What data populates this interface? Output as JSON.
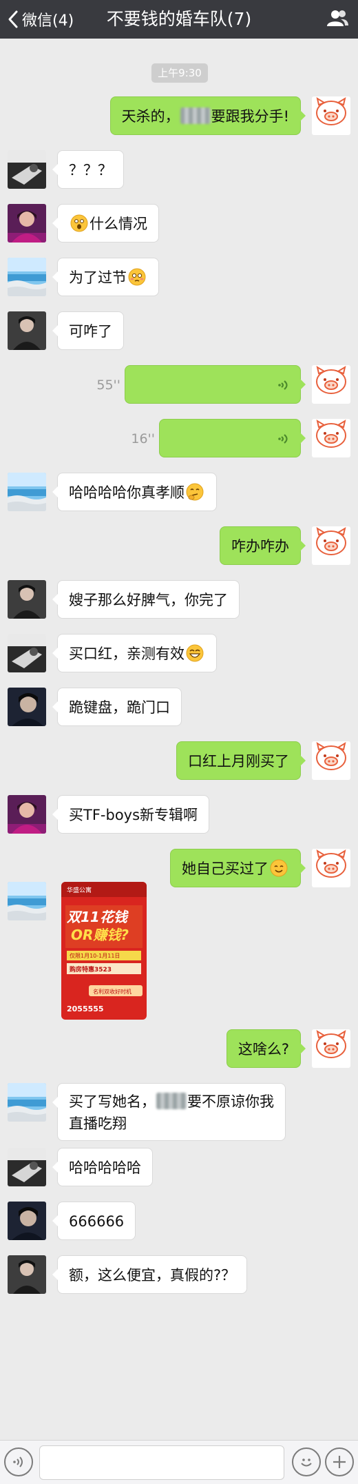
{
  "header": {
    "back_label": "微信(4)",
    "title": "不要钱的婚车队(7)"
  },
  "timestamp": "上午9:30",
  "messages": [
    {
      "side": "right",
      "avatar": "pig",
      "text_before": "天杀的，",
      "text_after": "要跟我分手!"
    },
    {
      "side": "left",
      "avatar": "dark",
      "text": "？？？"
    },
    {
      "side": "left",
      "avatar": "pink",
      "text": "什么情况",
      "emoji": "shocked-emoji"
    },
    {
      "side": "left",
      "avatar": "beach",
      "text": "为了过节",
      "emoji": "flushed-emoji"
    },
    {
      "side": "left",
      "avatar": "man",
      "text": "可咋了"
    },
    {
      "side": "right",
      "avatar": "pig",
      "voice": "55''"
    },
    {
      "side": "right",
      "avatar": "pig",
      "voice": "16''"
    },
    {
      "side": "left",
      "avatar": "beach",
      "text": "哈哈哈哈你真孝顺",
      "emoji": "thinking-emoji"
    },
    {
      "side": "right",
      "avatar": "pig",
      "text": "咋办咋办"
    },
    {
      "side": "left",
      "avatar": "man",
      "text": "嫂子那么好脾气，你完了"
    },
    {
      "side": "left",
      "avatar": "dark",
      "text": "买口红，亲测有效",
      "emoji": "grin-emoji"
    },
    {
      "side": "left",
      "avatar": "man2",
      "text": "跪键盘，跪门口"
    },
    {
      "side": "right",
      "avatar": "pig",
      "text": "口红上月刚买了"
    },
    {
      "side": "left",
      "avatar": "pink",
      "text": "买TF-boys新专辑啊"
    },
    {
      "side": "right",
      "avatar": "pig",
      "text": "她自己买过了",
      "emoji": "smile-emoji"
    },
    {
      "side": "left",
      "avatar": "beach",
      "image": "poster"
    },
    {
      "side": "right",
      "avatar": "pig",
      "text": "这啥么?"
    },
    {
      "side": "left",
      "avatar": "beach",
      "line1_before": "买了写她名，",
      "line1_after": "要不原谅你我",
      "line2": "直播吃翔"
    },
    {
      "side": "left",
      "avatar": "dark",
      "text": "哈哈哈哈哈"
    },
    {
      "side": "left",
      "avatar": "man2",
      "text": "666666"
    },
    {
      "side": "left",
      "avatar": "man",
      "text": "额，这么便宜，真假的?？"
    }
  ],
  "poster": {
    "brand": "华盛公寓",
    "headline1": "双11花钱",
    "headline2": "OR赚钱?",
    "line_a": "仅限1月10-1月11日",
    "line_b": "购房特惠3523",
    "line_c": "名利双收好时机",
    "phone": "2055555"
  },
  "pig_avatar_text": "I'm 肥猪",
  "icons": {
    "back": "chevron-left-icon",
    "group": "group-members-icon",
    "voice_mode": "voice-input-icon",
    "emoji": "emoji-icon",
    "more": "plus-icon"
  }
}
